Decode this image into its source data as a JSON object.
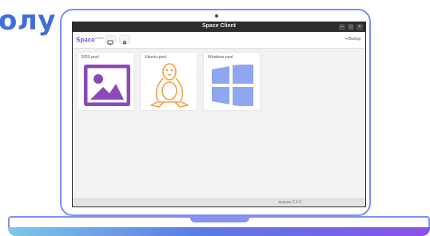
{
  "heading": "олу",
  "window": {
    "title": "Space Client",
    "controls": [
      "–",
      "□",
      "×"
    ]
  },
  "toolbar": {
    "logo": "Space",
    "logo_sup": "Client",
    "exit_label": "Выход"
  },
  "pools": [
    {
      "label": "RDS-pool",
      "icon": "image-icon"
    },
    {
      "label": "Ubuntu-pool",
      "icon": "linux-tux-icon"
    },
    {
      "label": "Windows-pool",
      "icon": "windows-icon"
    }
  ],
  "footer": {
    "version": "версия 2.4.0"
  },
  "colors": {
    "accent": "#3f6fd6",
    "rds": "#8b4ab8",
    "ubuntu": "#f0a040",
    "windows": "#8fa6f0"
  }
}
